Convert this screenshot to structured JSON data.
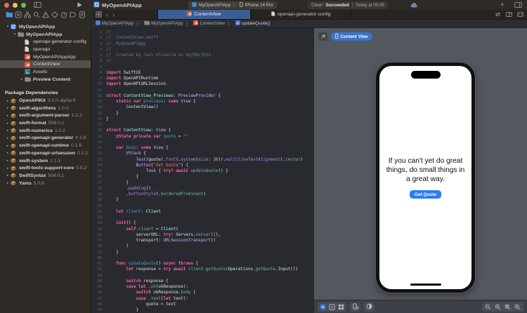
{
  "colors": {
    "xcode_accent_blue": "#3b5f93",
    "preview_pill_blue": "#3d73c8",
    "ios_button_blue": "#2e7bf6",
    "swift_orange": "#f05138"
  },
  "titlebar": {
    "project_title": "MyOpenAPIApp",
    "icons": [
      "sidebar-toggle-icon",
      "play-icon",
      "cloud-icon",
      "plus-icon",
      "editor-layout-icon"
    ],
    "scheme": {
      "app": "MyOpenAPIApp",
      "device": "iPhone 14 Pro"
    },
    "status": {
      "action": "Clean",
      "result": "Succeeded",
      "time": "Today at 00:35"
    }
  },
  "navigator": {
    "active": "project-navigator",
    "icons": [
      "project-navigator",
      "source-control-navigator",
      "symbol-navigator",
      "find-navigator",
      "issue-navigator",
      "test-navigator",
      "debug-navigator",
      "breakpoint-navigator",
      "report-navigator"
    ]
  },
  "tab_bar": {
    "left_icons": [
      "tab-overview-icon",
      "back-icon",
      "forward-icon"
    ],
    "tabs": [
      {
        "label": "ContentView",
        "icon": "swift",
        "active": true
      },
      {
        "label": "openapi-generator-config",
        "icon": "doc",
        "active": false
      }
    ],
    "right_icons": [
      "swap-editors-icon",
      "add-editor-icon",
      "focus-editor-icon"
    ]
  },
  "jump_bar": {
    "items": [
      {
        "label": "MyOpenAPIApp",
        "icon": "project"
      },
      {
        "label": "MyOpenAPIApp",
        "icon": "folder"
      },
      {
        "label": "ContentView",
        "icon": "swift"
      },
      {
        "label": "updateQuote()",
        "icon": "method"
      }
    ]
  },
  "sidebar": {
    "files": [
      {
        "label": "MyOpenAPIApp",
        "icon": "project",
        "depth": 0,
        "disclosure": "open",
        "bold": true
      },
      {
        "label": "MyOpenAPIApp",
        "icon": "folder",
        "depth": 1,
        "disclosure": "open",
        "bold": true
      },
      {
        "label": "openapi-generator-config",
        "icon": "doc",
        "depth": 2
      },
      {
        "label": "openapi",
        "icon": "doc",
        "depth": 2
      },
      {
        "label": "MyOpenAPIAppApp",
        "icon": "swift",
        "depth": 2
      },
      {
        "label": "ContentView",
        "icon": "swift",
        "depth": 2,
        "selected": true
      },
      {
        "label": "Assets",
        "icon": "assets",
        "depth": 2
      },
      {
        "label": "Preview Content",
        "icon": "folder",
        "depth": 2,
        "disclosure": "closed",
        "bold": true
      }
    ],
    "packages_header": "Package Dependencies",
    "packages": [
      {
        "name": "OpenAPIKit",
        "version": "3.0.0-alpha.9"
      },
      {
        "name": "swift-algorithms",
        "version": "1.0.0"
      },
      {
        "name": "swift-argument-parser",
        "version": "1.2.2"
      },
      {
        "name": "swift-format",
        "version": "508.0.1"
      },
      {
        "name": "swift-numerics",
        "version": "1.0.2"
      },
      {
        "name": "swift-openapi-generator",
        "version": "0.1.6"
      },
      {
        "name": "swift-openapi-runtime",
        "version": "0.1.6"
      },
      {
        "name": "swift-openapi-urlsession",
        "version": "0.1.2"
      },
      {
        "name": "swift-system",
        "version": "1.1.1"
      },
      {
        "name": "swift-tools-support-core",
        "version": "0.5.2"
      },
      {
        "name": "SwiftSyntax",
        "version": "508.0.1"
      },
      {
        "name": "Yams",
        "version": "5.0.6"
      }
    ]
  },
  "editor": {
    "lines": [
      [
        [
          "c",
          "//"
        ]
      ],
      [
        [
          "c",
          "//  ContentView.swift"
        ]
      ],
      [
        [
          "c",
          "//  MyOpenAPIApp"
        ]
      ],
      [
        [
          "c",
          "//"
        ]
      ],
      [
        [
          "c",
          "//  Created by Joel Oliveira on 02/08/2023."
        ]
      ],
      [
        [
          "c",
          "//"
        ]
      ],
      [],
      [
        [
          "k",
          "import"
        ],
        [
          "p",
          " SwiftUI"
        ]
      ],
      [
        [
          "k",
          "import"
        ],
        [
          "p",
          " OpenAPIRuntime"
        ]
      ],
      [
        [
          "k",
          "import"
        ],
        [
          "p",
          " OpenAPIURLSession"
        ]
      ],
      [],
      [
        [
          "k",
          "struct"
        ],
        [
          "t",
          " ContentView_Previews"
        ],
        [
          "p",
          ": "
        ],
        [
          "r",
          "PreviewProvider"
        ],
        [
          "p",
          " {"
        ]
      ],
      [
        [
          "p",
          "    "
        ],
        [
          "k",
          "static var"
        ],
        [
          "d",
          " previews"
        ],
        [
          "p",
          ": "
        ],
        [
          "k",
          "some"
        ],
        [
          "r",
          " View"
        ],
        [
          "p",
          " {"
        ]
      ],
      [
        [
          "p",
          "        "
        ],
        [
          "t",
          "ContentView"
        ],
        [
          "p",
          "()"
        ]
      ],
      [
        [
          "p",
          "    }"
        ]
      ],
      [
        [
          "p",
          "}"
        ]
      ],
      [],
      [
        [
          "k",
          "struct"
        ],
        [
          "t",
          " ContentView"
        ],
        [
          "p",
          ": "
        ],
        [
          "r",
          "View"
        ],
        [
          "p",
          " {"
        ]
      ],
      [
        [
          "p",
          "    "
        ],
        [
          "k",
          "@State"
        ],
        [
          "p",
          " "
        ],
        [
          "k",
          "private var"
        ],
        [
          "d",
          " quote"
        ],
        [
          "p",
          " = "
        ],
        [
          "s",
          "\"\""
        ]
      ],
      [],
      [
        [
          "p",
          "    "
        ],
        [
          "k",
          "var"
        ],
        [
          "d",
          " body"
        ],
        [
          "p",
          ": "
        ],
        [
          "k",
          "some"
        ],
        [
          "r",
          " View"
        ],
        [
          "p",
          " {"
        ]
      ],
      [
        [
          "p",
          "        "
        ],
        [
          "r",
          "VStack"
        ],
        [
          "p",
          " {"
        ]
      ],
      [
        [
          "p",
          "            "
        ],
        [
          "r",
          "Text"
        ],
        [
          "p",
          "(quote)."
        ],
        [
          "f",
          "font"
        ],
        [
          "p",
          "(."
        ],
        [
          "f",
          "system"
        ],
        [
          "p",
          "("
        ],
        [
          "g",
          "size"
        ],
        [
          "p",
          ": "
        ],
        [
          "n",
          "30"
        ],
        [
          "p",
          "))."
        ],
        [
          "f",
          "multilineTextAlignment"
        ],
        [
          "p",
          "(."
        ],
        [
          "g",
          "center"
        ],
        [
          "p",
          ")"
        ]
      ],
      [
        [
          "p",
          "            "
        ],
        [
          "r",
          "Button"
        ],
        [
          "p",
          "("
        ],
        [
          "s",
          "\"Get Quote\""
        ],
        [
          "p",
          ") {"
        ]
      ],
      [
        [
          "p",
          "                "
        ],
        [
          "r",
          "Task"
        ],
        [
          "p",
          " { "
        ],
        [
          "k",
          "try?"
        ],
        [
          "p",
          " "
        ],
        [
          "k",
          "await"
        ],
        [
          "p",
          " "
        ],
        [
          "g",
          "updateQuote"
        ],
        [
          "p",
          "() }"
        ]
      ],
      [
        [
          "p",
          "            }"
        ]
      ],
      [
        [
          "p",
          "        }"
        ]
      ],
      [
        [
          "p",
          "        ."
        ],
        [
          "f",
          "padding"
        ],
        [
          "p",
          "()"
        ]
      ],
      [
        [
          "p",
          "        ."
        ],
        [
          "f",
          "buttonStyle"
        ],
        [
          "p",
          "(."
        ],
        [
          "g",
          "borderedProminent"
        ],
        [
          "p",
          ")"
        ]
      ],
      [
        [
          "p",
          "    }"
        ]
      ],
      [],
      [
        [
          "p",
          "    "
        ],
        [
          "k",
          "let"
        ],
        [
          "d",
          " client"
        ],
        [
          "p",
          ": "
        ],
        [
          "t",
          "Client"
        ]
      ],
      [],
      [
        [
          "p",
          "    "
        ],
        [
          "k",
          "init"
        ],
        [
          "p",
          "() {"
        ]
      ],
      [
        [
          "p",
          "        "
        ],
        [
          "k",
          "self"
        ],
        [
          "p",
          "."
        ],
        [
          "g",
          "client"
        ],
        [
          "p",
          " = "
        ],
        [
          "t",
          "Client"
        ],
        [
          "p",
          "("
        ]
      ],
      [
        [
          "p",
          "            serverURL: "
        ],
        [
          "k",
          "try!"
        ],
        [
          "p",
          " "
        ],
        [
          "t",
          "Servers"
        ],
        [
          "p",
          "."
        ],
        [
          "g",
          "server1"
        ],
        [
          "p",
          "(),"
        ]
      ],
      [
        [
          "p",
          "            transport: "
        ],
        [
          "r",
          "URLSessionTransport"
        ],
        [
          "p",
          "()"
        ]
      ],
      [
        [
          "p",
          "        )"
        ]
      ],
      [
        [
          "p",
          "    }"
        ]
      ],
      [],
      [
        [
          "p",
          "    "
        ],
        [
          "k",
          "func"
        ],
        [
          "d",
          " updateQuote"
        ],
        [
          "p",
          "() "
        ],
        [
          "k",
          "async throws"
        ],
        [
          "p",
          " {"
        ]
      ],
      [
        [
          "p",
          "        "
        ],
        [
          "k",
          "let"
        ],
        [
          "p",
          " response = "
        ],
        [
          "k",
          "try await"
        ],
        [
          "p",
          " "
        ],
        [
          "g",
          "client"
        ],
        [
          "p",
          "."
        ],
        [
          "g",
          "getQuote"
        ],
        [
          "p",
          "("
        ],
        [
          "t",
          "Operations"
        ],
        [
          "p",
          "."
        ],
        [
          "g",
          "getQuote"
        ],
        [
          "p",
          "."
        ],
        [
          "t",
          "Input"
        ],
        [
          "p",
          "())"
        ]
      ],
      [],
      [
        [
          "p",
          "        "
        ],
        [
          "k",
          "switch"
        ],
        [
          "p",
          " response {"
        ]
      ],
      [
        [
          "p",
          "        "
        ],
        [
          "k",
          "case let"
        ],
        [
          "p",
          " ."
        ],
        [
          "g",
          "ok"
        ],
        [
          "p",
          "(okResponse):"
        ]
      ],
      [
        [
          "p",
          "            "
        ],
        [
          "k",
          "switch"
        ],
        [
          "p",
          " okResponse."
        ],
        [
          "g",
          "body"
        ],
        [
          "p",
          " {"
        ]
      ],
      [
        [
          "p",
          "            "
        ],
        [
          "k",
          "case"
        ],
        [
          "p",
          " ."
        ],
        [
          "g",
          "text"
        ],
        [
          "p",
          "("
        ],
        [
          "k",
          "let"
        ],
        [
          "p",
          " text):"
        ]
      ],
      [
        [
          "p",
          "                quote = text"
        ]
      ],
      [
        [
          "p",
          "            }"
        ]
      ]
    ]
  },
  "canvas": {
    "preview_pill": {
      "label": "Content View",
      "icon": "device-icon"
    },
    "bottom_bar": {
      "left_icons": [
        "live-preview-icon",
        "selectable-preview-icon",
        "variants-icon",
        "device-settings-icon",
        "color-scheme-icon"
      ],
      "zoom_icons": [
        "zoom-out-icon",
        "zoom-actual-size-icon",
        "zoom-fit-icon",
        "zoom-in-icon"
      ]
    },
    "phone": {
      "quote": "If you can't yet do great things, do small things in a great way.",
      "button_label": "Get Quote",
      "button_color": "#2e7bf6"
    }
  }
}
